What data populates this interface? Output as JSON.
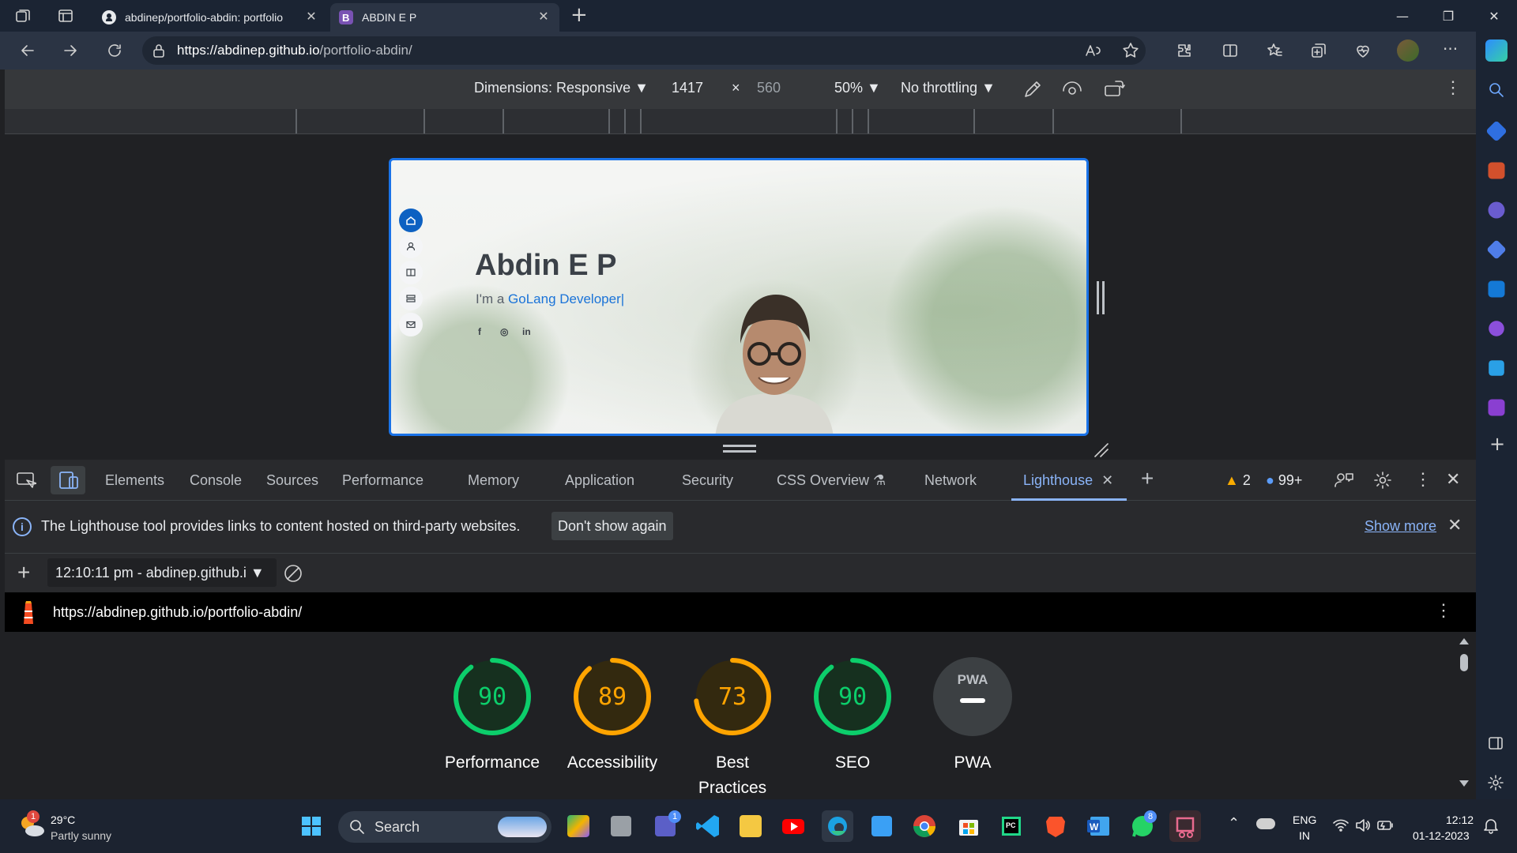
{
  "browser": {
    "tabs": [
      {
        "label": "abdinep/portfolio-abdin: portfolio",
        "favicon": "github-icon",
        "active": false
      },
      {
        "label": "ABDIN E P",
        "favicon": "bootstrap-icon",
        "active": true
      }
    ],
    "url_host": "https://abdinep.github.io",
    "url_path": "/portfolio-abdin/",
    "new_tab_symbol": "+"
  },
  "device_toolbar": {
    "dimensions_label": "Dimensions: Responsive",
    "width": "1417",
    "times": "×",
    "height": "560",
    "zoom": "50%",
    "throttling": "No throttling"
  },
  "hero": {
    "name": "Abdin E P",
    "intro": "I'm a ",
    "role": "GoLang Developer|",
    "socials": [
      "f",
      "◎",
      "in"
    ]
  },
  "devtools": {
    "tabs": [
      "Elements",
      "Console",
      "Sources",
      "Performance",
      "Memory",
      "Application",
      "Security",
      "CSS Overview",
      "Network",
      "Lighthouse"
    ],
    "active_tab": "Lighthouse",
    "warnings": "2",
    "messages": "99+"
  },
  "infobar": {
    "message": "The Lighthouse tool provides links to content hosted on third-party websites.",
    "dont_show": "Don't show again",
    "show_more": "Show more"
  },
  "report": {
    "selector": "12:10:11 pm - abdinep.github.i",
    "url": "https://abdinep.github.io/portfolio-abdin/"
  },
  "scores": [
    {
      "value": "90",
      "label": "Performance",
      "fraction": 0.9,
      "color": "#0cce6b"
    },
    {
      "value": "89",
      "label": "Accessibility",
      "fraction": 0.89,
      "color": "#ffa400"
    },
    {
      "value": "73",
      "label": "Best Practices",
      "label_line1": "Best",
      "label_line2": "Practices",
      "fraction": 0.73,
      "color": "#ffa400"
    },
    {
      "value": "90",
      "label": "SEO",
      "fraction": 0.9,
      "color": "#0cce6b"
    },
    {
      "value": "PWA",
      "label": "PWA",
      "fraction": 0,
      "color": "#9aa0a6"
    }
  ],
  "taskbar": {
    "weather_temp": "29°C",
    "weather_desc": "Partly sunny",
    "weather_badge": "1",
    "search_label": "Search",
    "teams_badge": "1",
    "whatsapp_badge": "8",
    "lang1": "ENG",
    "lang2": "IN",
    "time": "12:12",
    "date": "01-12-2023"
  },
  "colors": {
    "accent_blue": "#1a73e8",
    "score_green": "#0cce6b",
    "score_orange": "#ffa400"
  }
}
